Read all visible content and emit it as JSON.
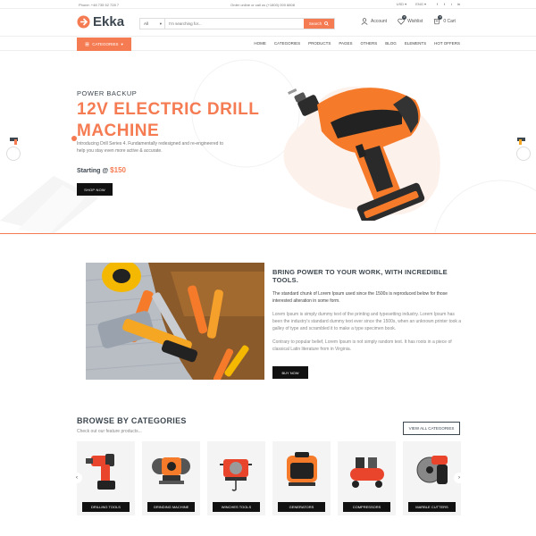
{
  "topbar": {
    "phone": "Phone: +48 735 52 728 7",
    "center": "Order online or call us (+1800) 000 8808",
    "currency": "USD ▾",
    "language": "ENG ▾",
    "social": [
      "f",
      "t",
      "i",
      "in"
    ]
  },
  "header": {
    "logo": "Ekka",
    "search": {
      "category": "All",
      "placeholder": "I'm searching for...",
      "button": "Search"
    },
    "account": "Account",
    "wishlist": "Wishlist",
    "wishlist_count": "0",
    "cart": "Cart",
    "cart_count": "0",
    "cart_label": "0 Cart"
  },
  "nav": {
    "categories_button": "CATEGORIES",
    "links": [
      "HOME",
      "CATEGORIES",
      "PRODUCTS",
      "PAGES",
      "OTHERS",
      "BLOG",
      "ELEMENTS",
      "HOT OFFERS"
    ]
  },
  "hero": {
    "subtitle": "POWER BACKUP",
    "title_line1": "12V ELECTRIC DRILL",
    "title_line2": "MACHINE",
    "description": "Introducing Drill Series 4. Fundamentally redesigned and re-engineered to help you stay even more active & accurate.",
    "price_label": "Starting @ ",
    "price_value": "$150",
    "button": "SHOP NOW"
  },
  "promo": {
    "heading": "BRING POWER TO YOUR WORK, WITH INCREDIBLE TOOLS.",
    "para1": "The standard chunk of Lorem Ipsum used since the 1500s is reproduced below for those interested alteration in some form.",
    "para2": "Lorem Ipsum is simply dummy text of the printing and typesetting industry. Lorem Ipsum has been the industry's standard dummy text ever since the 1500s, when an unknown printer took a galley of type and scrambled it to make a type specimen book.",
    "para3": "Contrary to popular belief, Lorem Ipsum is not simply random text. It has roots in a piece of classical Latin literature from in Virginia.",
    "button": "BUY NOW"
  },
  "categories": {
    "title": "BROWSE BY CATEGORIES",
    "subtitle": "Check out our feature products...",
    "view_all": "VIEW ALL CATEGORIES",
    "items": [
      {
        "label": "DRILLING TOOLS"
      },
      {
        "label": "GRINDING MACHINE"
      },
      {
        "label": "WINCHES TOOLS"
      },
      {
        "label": "GENERATORS"
      },
      {
        "label": "COMPRESSORS"
      },
      {
        "label": "MARBLE CUTTERS"
      }
    ]
  },
  "colors": {
    "accent": "#f57b52",
    "dark": "#3d4750",
    "black": "#111111"
  },
  "icons": [
    "logo-icon",
    "user-icon",
    "heart-icon",
    "cart-icon",
    "search-icon",
    "menu-icon",
    "arrow-left-icon",
    "arrow-right-icon"
  ]
}
